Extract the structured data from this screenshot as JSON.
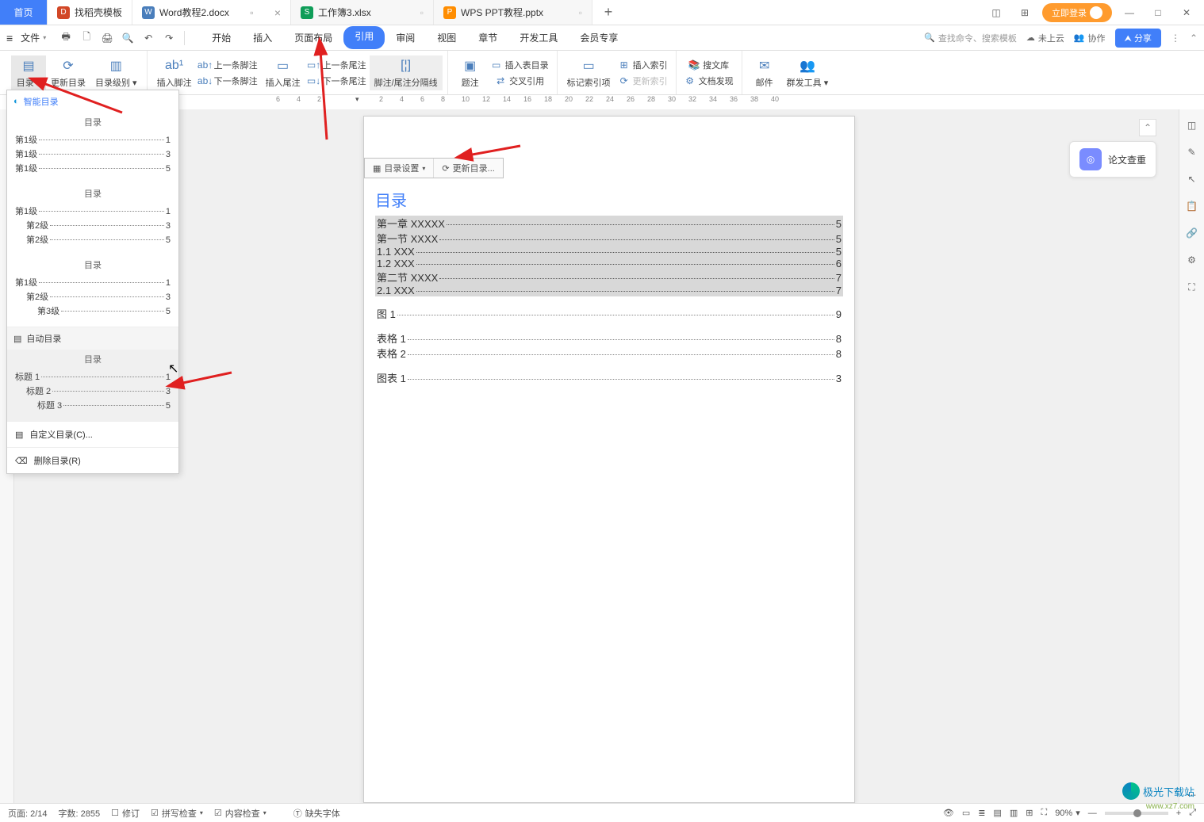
{
  "titlebar": {
    "tabs": [
      {
        "label": "首页",
        "kind": "home"
      },
      {
        "label": "找稻壳模板",
        "kind": "doc"
      },
      {
        "label": "Word教程2.docx",
        "kind": "word",
        "active": true
      },
      {
        "label": "工作簿3.xlsx",
        "kind": "xls"
      },
      {
        "label": "WPS PPT教程.pptx",
        "kind": "ppt"
      }
    ],
    "login": "立即登录"
  },
  "menubar": {
    "file": "文件",
    "tabs": [
      "开始",
      "插入",
      "页面布局",
      "引用",
      "审阅",
      "视图",
      "章节",
      "开发工具",
      "会员专享"
    ],
    "active_tab": "引用",
    "search_placeholder": "查找命令、搜索模板",
    "cloud": "未上云",
    "collab": "协作",
    "share": "分享"
  },
  "ribbon": {
    "toc": "目录",
    "update_toc": "更新目录",
    "toc_level": "目录级别",
    "insert_footnote": "插入脚注",
    "prev_footnote": "上一条脚注",
    "next_footnote": "下一条脚注",
    "insert_endnote": "插入尾注",
    "prev_endnote": "上一条尾注",
    "next_endnote": "下一条尾注",
    "fn_sep": "脚注/尾注分隔线",
    "caption": "题注",
    "insert_fig_toc": "插入表目录",
    "cross_ref": "交叉引用",
    "mark_index": "标记索引项",
    "insert_index": "插入索引",
    "update_index": "更新索引",
    "refs_lib": "搜文库",
    "doc_discover": "文档发现",
    "mail": "邮件",
    "group_send": "群发工具"
  },
  "ruler_ticks": [
    "6",
    "4",
    "2",
    "",
    "2",
    "4",
    "6",
    "8",
    "10",
    "12",
    "14",
    "16",
    "18",
    "20",
    "22",
    "24",
    "26",
    "28",
    "30",
    "32",
    "34",
    "36",
    "38",
    "40"
  ],
  "toc_dropdown": {
    "smart": "智能目录",
    "preview_title": "目录",
    "auto": "自动目录",
    "custom": "自定义目录(C)...",
    "delete": "删除目录(R)",
    "set1": [
      {
        "lbl": "第1级",
        "pg": "1",
        "ind": 0
      },
      {
        "lbl": "第1级",
        "pg": "3",
        "ind": 0
      },
      {
        "lbl": "第1级",
        "pg": "5",
        "ind": 0
      }
    ],
    "set2": [
      {
        "lbl": "第1级",
        "pg": "1",
        "ind": 0
      },
      {
        "lbl": "第2级",
        "pg": "3",
        "ind": 1
      },
      {
        "lbl": "第2级",
        "pg": "5",
        "ind": 1
      }
    ],
    "set3": [
      {
        "lbl": "第1级",
        "pg": "1",
        "ind": 0
      },
      {
        "lbl": "第2级",
        "pg": "3",
        "ind": 1
      },
      {
        "lbl": "第3级",
        "pg": "5",
        "ind": 2
      }
    ],
    "set4": [
      {
        "lbl": "标题 1",
        "pg": "1",
        "ind": 0
      },
      {
        "lbl": "标题 2",
        "pg": "3",
        "ind": 1
      },
      {
        "lbl": "标题 3",
        "pg": "5",
        "ind": 2
      }
    ]
  },
  "page_toolbar": {
    "settings": "目录设置",
    "update": "更新目录..."
  },
  "document": {
    "toc_title": "目录",
    "toc_lines": [
      {
        "lbl": "第一章  XXXXX",
        "pg": "5",
        "ind": 0
      },
      {
        "lbl": "第一节  XXXX",
        "pg": "5",
        "ind": 1
      },
      {
        "lbl": "1.1 XXX",
        "pg": "5",
        "ind": 2
      },
      {
        "lbl": "1.2 XXX",
        "pg": "6",
        "ind": 2
      },
      {
        "lbl": "第二节  XXXX",
        "pg": "7",
        "ind": 1
      },
      {
        "lbl": "2.1 XXX",
        "pg": "7",
        "ind": 2
      }
    ],
    "fig": {
      "lbl": "图  1",
      "pg": "9"
    },
    "tables": [
      {
        "lbl": "表格  1",
        "pg": "8"
      },
      {
        "lbl": "表格  2",
        "pg": "8"
      }
    ],
    "chart": {
      "lbl": "图表  1",
      "pg": "3"
    }
  },
  "float": {
    "label": "论文查重"
  },
  "status": {
    "page": "页面: 2/14",
    "words": "字数: 2855",
    "revise": "修订",
    "spell": "拼写检查",
    "content": "内容检查",
    "font_missing": "缺失字体",
    "zoom": "90%"
  },
  "watermark": {
    "main": "极光下载站",
    "sub": "www.xz7.com"
  }
}
